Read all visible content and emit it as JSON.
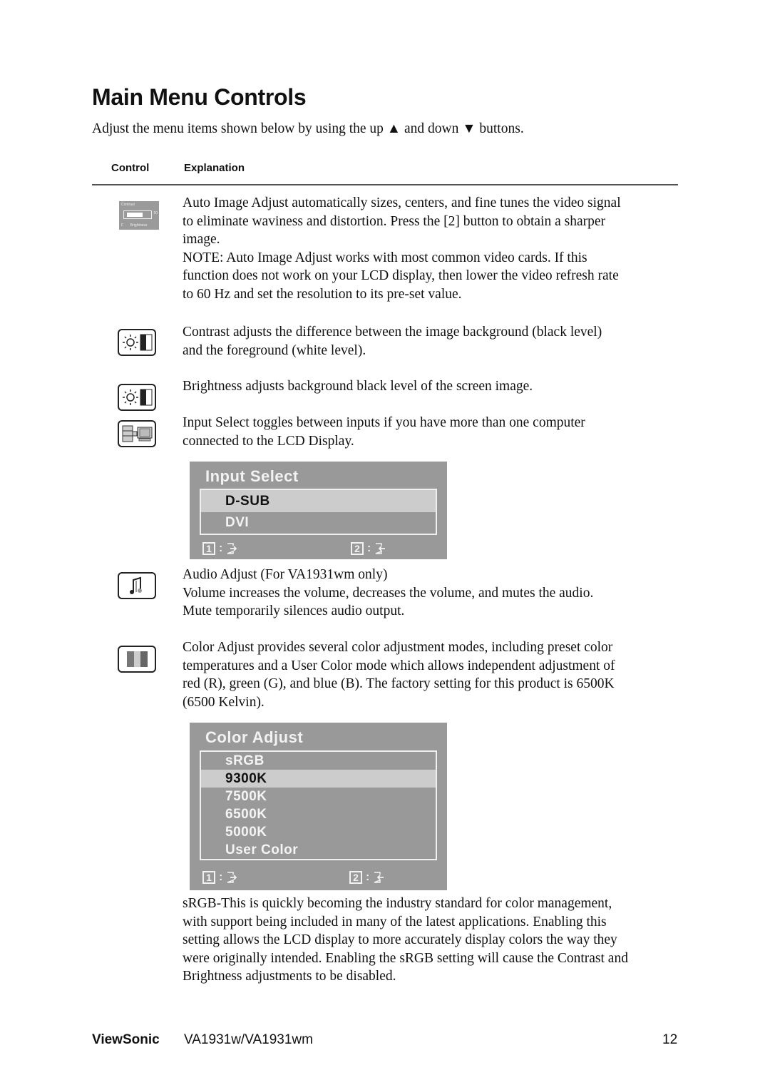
{
  "page": {
    "title": "Main Menu Controls",
    "intro": "Adjust the menu items shown below by using the up ▲ and down ▼ buttons."
  },
  "table": {
    "headers": {
      "control": "Control",
      "explanation": "Explanation"
    }
  },
  "controls": [
    {
      "icon": "auto-image-adjust-icon",
      "icon_thumb": {
        "title": "Contrast",
        "value": "50",
        "left": "F",
        "right": "Brightness"
      },
      "lines": [
        "Auto Image Adjust automatically sizes, centers, and fine tunes the video signal",
        "to eliminate waviness and distortion. Press the [2] button to obtain a sharper",
        "image.",
        "NOTE: Auto Image Adjust works with most common video cards. If this",
        "function does not work on your LCD display, then lower the video refresh rate",
        "to 60 Hz and set the resolution to its pre-set value."
      ]
    },
    {
      "icon": "contrast-icon",
      "lines": [
        "Contrast adjusts the difference between the image background  (black level)",
        "and the foreground (white level)."
      ]
    },
    {
      "icon": "brightness-icon",
      "lines": [
        "Brightness adjusts background black level of the screen image."
      ]
    },
    {
      "icon": "input-select-icon",
      "lines": [
        "Input Select toggles between inputs if you have more than one computer",
        "connected to the LCD Display."
      ]
    },
    {
      "icon": "audio-adjust-icon",
      "lines": [
        "Audio Adjust (For VA1931wm only)",
        "Volume increases the volume, decreases the volume, and mutes the audio.",
        "Mute temporarily silences audio output."
      ]
    },
    {
      "icon": "color-adjust-icon",
      "lines": [
        "Color Adjust provides several color adjustment modes, including preset color",
        "temperatures and a User Color mode which allows independent adjustment of",
        "red (R), green (G), and blue (B). The factory setting for this product is 6500K",
        "(6500 Kelvin)."
      ]
    }
  ],
  "osd_input_select": {
    "title": "Input Select",
    "items": [
      "D-SUB",
      "DVI"
    ],
    "selected": "D-SUB",
    "key1": "1",
    "key2": "2",
    "colon": ":"
  },
  "osd_color_adjust": {
    "title": "Color Adjust",
    "items": [
      "sRGB",
      "9300K",
      "7500K",
      "6500K",
      "5000K",
      "User Color"
    ],
    "selected": "9300K",
    "key1": "1",
    "key2": "2",
    "colon": ":"
  },
  "srgb_note": [
    "sRGB-This is quickly becoming the industry standard for color management,",
    "with support being included in many of the latest applications. Enabling this",
    "setting allows the LCD display to more accurately display colors the way they",
    "were originally intended. Enabling the sRGB setting will cause the Contrast and",
    "Brightness adjustments to be disabled."
  ],
  "footer": {
    "brand": "ViewSonic",
    "model": "VA1931w/VA1931wm",
    "page_number": "12"
  },
  "colors": {
    "osd_background": "#999999",
    "osd_selected": "#cccccc",
    "text": "#111111"
  }
}
